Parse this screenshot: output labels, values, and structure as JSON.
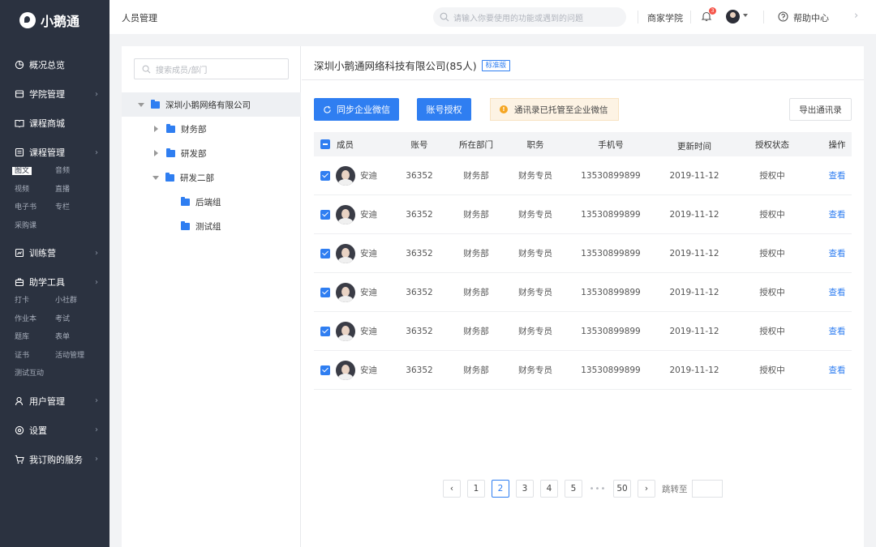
{
  "app": {
    "name": "小鹅通"
  },
  "sidebar": {
    "items": [
      {
        "label": "概况总览",
        "icon": "pie-chart-icon",
        "chevron": false
      },
      {
        "label": "学院管理",
        "icon": "store-icon",
        "chevron": true
      },
      {
        "label": "课程商城",
        "icon": "book-icon",
        "chevron": false
      },
      {
        "label": "课程管理",
        "icon": "list-icon",
        "chevron": true
      },
      {
        "label": "训练营",
        "icon": "training-icon",
        "chevron": true
      },
      {
        "label": "助学工具",
        "icon": "toolbox-icon",
        "chevron": true
      },
      {
        "label": "用户管理",
        "icon": "user-icon",
        "chevron": true
      },
      {
        "label": "设置",
        "icon": "settings-icon",
        "chevron": true
      },
      {
        "label": "我订购的服务",
        "icon": "cart-icon",
        "chevron": true
      }
    ],
    "course_sub": [
      "图文",
      "音频",
      "视频",
      "直播",
      "电子书",
      "专栏",
      "采购课"
    ],
    "tools_sub": [
      "打卡",
      "小社群",
      "作业本",
      "考试",
      "题库",
      "表单",
      "证书",
      "活动管理",
      "测试互动"
    ],
    "chevron": "›"
  },
  "header": {
    "page_title": "人员管理",
    "search_placeholder": "请输入你要使用的功能或遇到的问题",
    "merchant_academy": "商家学院",
    "notification_count": "3",
    "help": "帮助中心",
    "chevron_right": "›"
  },
  "tree": {
    "search_placeholder": "搜索成员/部门",
    "nodes": [
      {
        "label": "深圳小鹅网络有限公司"
      },
      {
        "label": "财务部"
      },
      {
        "label": "研发部"
      },
      {
        "label": "研发二部"
      },
      {
        "label": "后端组"
      },
      {
        "label": "测试组"
      }
    ]
  },
  "content": {
    "company": "深圳小鹅通网络科技有限公司(85人)",
    "edition": "标准版",
    "sync_button": "同步企业微信",
    "auth_button": "账号授权",
    "notice": "通讯录已托管至企业微信",
    "notice_mark": "!",
    "export_button": "导出通讯录"
  },
  "table": {
    "columns": [
      "成员",
      "账号",
      "所在部门",
      "职务",
      "手机号",
      "更新时间",
      "授权状态",
      "操作"
    ],
    "rows": [
      {
        "name": "安迪",
        "account": "36352",
        "dept": "财务部",
        "position": "财务专员",
        "phone": "13530899899",
        "updated": "2019-11-12",
        "status": "授权中",
        "action": "查看"
      },
      {
        "name": "安迪",
        "account": "36352",
        "dept": "财务部",
        "position": "财务专员",
        "phone": "13530899899",
        "updated": "2019-11-12",
        "status": "授权中",
        "action": "查看"
      },
      {
        "name": "安迪",
        "account": "36352",
        "dept": "财务部",
        "position": "财务专员",
        "phone": "13530899899",
        "updated": "2019-11-12",
        "status": "授权中",
        "action": "查看"
      },
      {
        "name": "安迪",
        "account": "36352",
        "dept": "财务部",
        "position": "财务专员",
        "phone": "13530899899",
        "updated": "2019-11-12",
        "status": "授权中",
        "action": "查看"
      },
      {
        "name": "安迪",
        "account": "36352",
        "dept": "财务部",
        "position": "财务专员",
        "phone": "13530899899",
        "updated": "2019-11-12",
        "status": "授权中",
        "action": "查看"
      },
      {
        "name": "安迪",
        "account": "36352",
        "dept": "财务部",
        "position": "财务专员",
        "phone": "13530899899",
        "updated": "2019-11-12",
        "status": "授权中",
        "action": "查看"
      }
    ]
  },
  "pagination": {
    "prev": "‹",
    "pages": [
      "1",
      "2",
      "3",
      "4",
      "5"
    ],
    "current": "2",
    "ellipsis": "•••",
    "last": "50",
    "next": "›",
    "jump_label": "跳转至"
  },
  "colors": {
    "primary": "#2f7ef1",
    "sidebar_bg": "#2b3240",
    "warning": "#f5a623",
    "badge": "#f5554a"
  }
}
